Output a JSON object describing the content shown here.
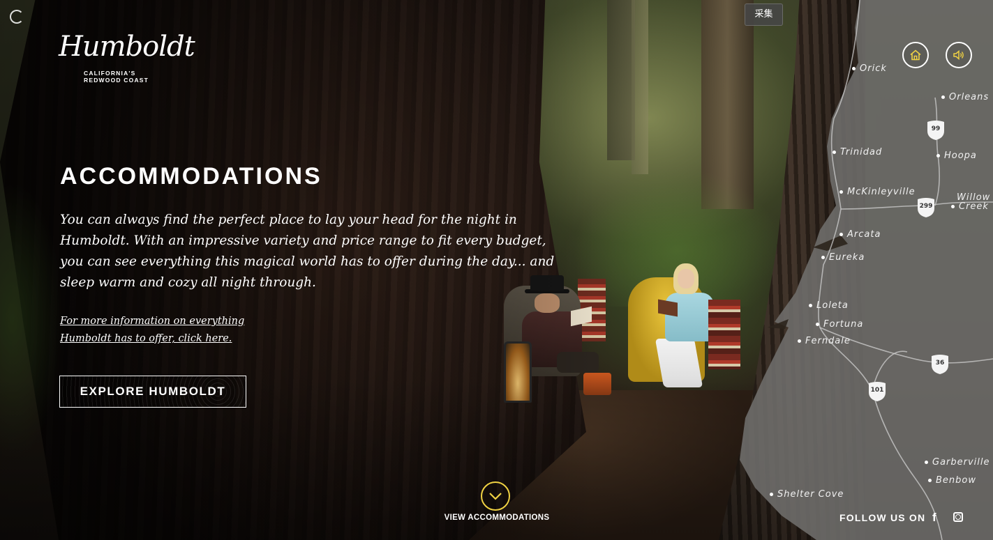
{
  "header": {
    "logo_script": "Humboldt",
    "logo_sub_line1": "CALIFORNIA'S",
    "logo_sub_line2": "REDWOOD COAST",
    "collect_label": "采集",
    "home_icon": "home-icon",
    "sound_icon": "speaker-icon"
  },
  "main": {
    "title": "ACCOMMODATIONS",
    "lead": "You can always find the perfect place to lay your head for the night in Humboldt. With an impressive variety and price range to fit every budget, you can see everything this magical world has to offer during the day... and sleep warm and cozy all night through.",
    "more_link_line1": "For more information on everything",
    "more_link_line2": "Humboldt has to offer, click here.",
    "explore_button": "EXPLORE HUMBOLDT"
  },
  "footer": {
    "view_label": "VIEW ACCOMMODATIONS",
    "follow_label": "FOLLOW US ON",
    "social": [
      "facebook-icon",
      "instagram-icon"
    ]
  },
  "map": {
    "towns": {
      "orick": "Orick",
      "orleans": "Orleans",
      "trinidad": "Trinidad",
      "hoopa": "Hoopa",
      "mckinleyville": "McKinleyville",
      "willow_creek_1": "Willow",
      "willow_creek_2": "Creek",
      "arcata": "Arcata",
      "eureka": "Eureka",
      "loleta": "Loleta",
      "fortuna": "Fortuna",
      "ferndale": "Ferndale",
      "garberville": "Garberville",
      "benbow": "Benbow",
      "shelter_cove": "Shelter Cove"
    },
    "routes": {
      "r99": "99",
      "r299": "299",
      "r36": "36",
      "r101": "101"
    }
  },
  "colors": {
    "accent_yellow": "#f0d243",
    "map_land": "#6f6e6c"
  }
}
